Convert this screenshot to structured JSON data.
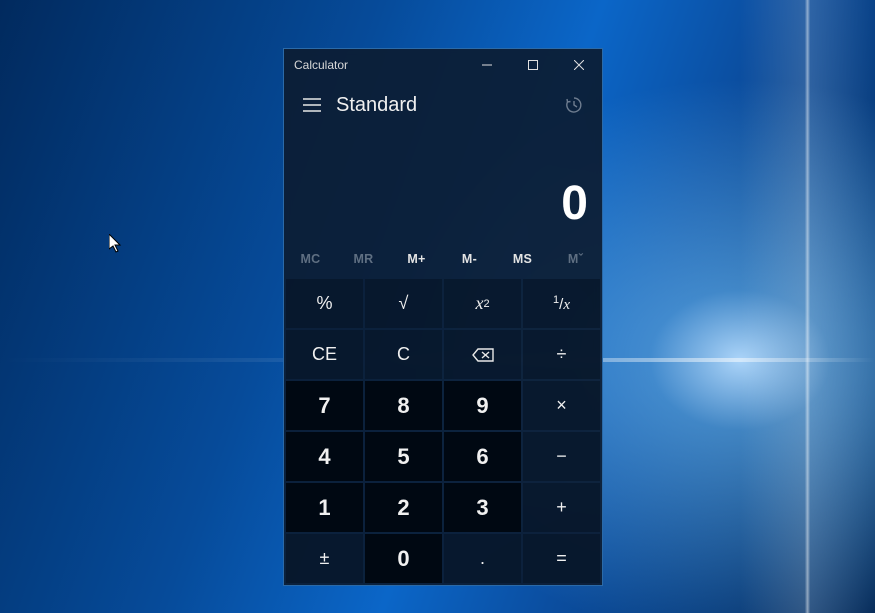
{
  "window": {
    "title": "Calculator",
    "mode": "Standard"
  },
  "display": {
    "value": "0"
  },
  "memory": {
    "mc": "MC",
    "mr": "MR",
    "mplus": "M+",
    "mminus": "M-",
    "ms": "MS",
    "mlist": "Mˇ"
  },
  "keys": {
    "percent": "%",
    "sqrt": "√",
    "square_x": "x",
    "square_sup": "2",
    "reciprocal_num": "1",
    "reciprocal_sep": "/",
    "reciprocal_x": "x",
    "ce": "CE",
    "c": "C",
    "divide": "÷",
    "n7": "7",
    "n8": "8",
    "n9": "9",
    "multiply": "×",
    "n4": "4",
    "n5": "5",
    "n6": "6",
    "minus": "−",
    "n1": "1",
    "n2": "2",
    "n3": "3",
    "plus": "+",
    "negate": "±",
    "n0": "0",
    "decimal": ".",
    "equals": "="
  }
}
